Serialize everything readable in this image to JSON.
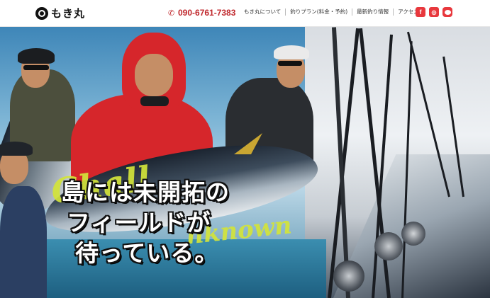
{
  "header": {
    "logo_text": "もき丸",
    "phone": "090-6761-7383",
    "nav": [
      "もき丸について",
      "釣りプラン(料金・予約)",
      "最新釣り情報",
      "アクセス"
    ],
    "social": [
      {
        "name": "facebook",
        "glyph": "f",
        "color": "#e8383d"
      },
      {
        "name": "instagram",
        "glyph": "◎",
        "color": "#e8383d"
      },
      {
        "name": "line",
        "glyph": "LINE",
        "color": "#e8383d"
      }
    ]
  },
  "hero": {
    "headline": [
      "島には未開拓の",
      "フィールドが",
      "待っている。"
    ],
    "overlay_script": [
      "Chall",
      "nknown"
    ],
    "overlay_color": "#d3e43a"
  }
}
